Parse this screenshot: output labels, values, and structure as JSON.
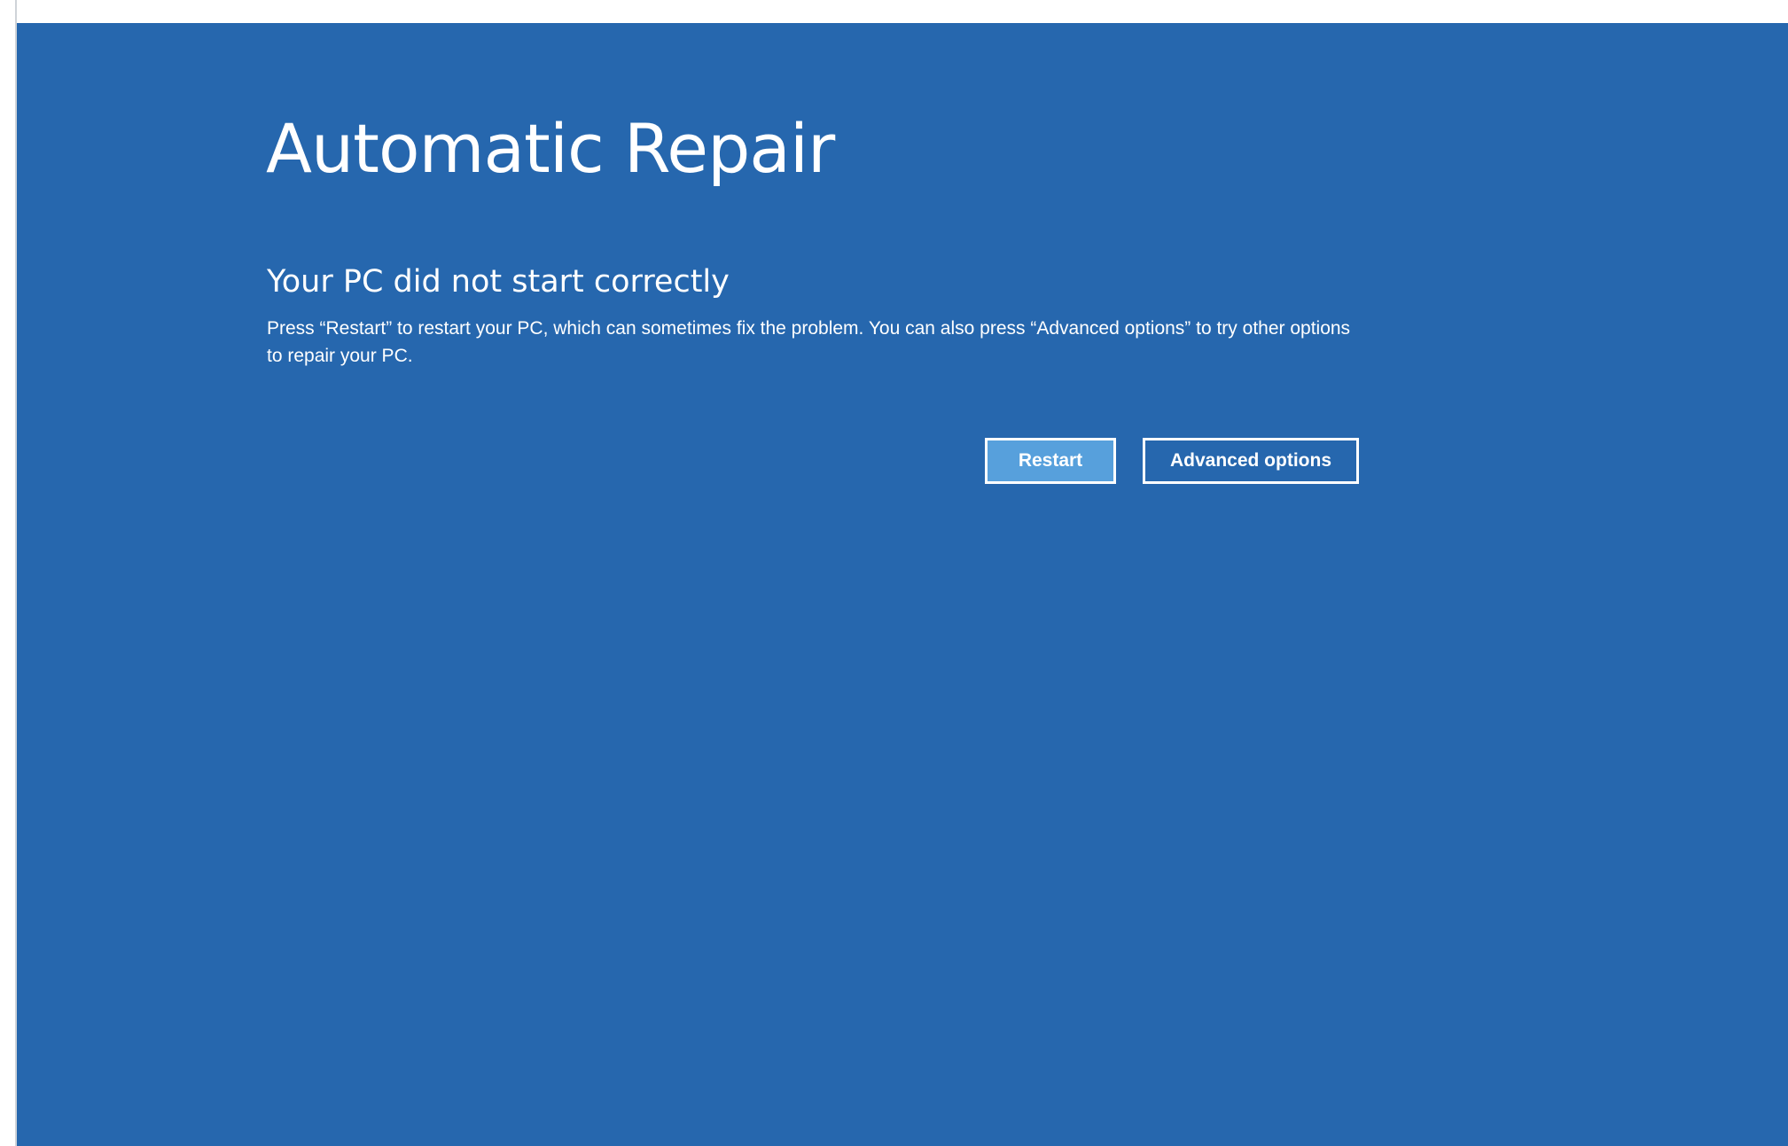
{
  "screen": {
    "title": "Automatic Repair",
    "subtitle": "Your PC did not start correctly",
    "description": "Press “Restart” to restart your PC, which can sometimes fix the problem. You can also press “Advanced options” to try other options to repair your PC."
  },
  "buttons": {
    "restart_label": "Restart",
    "advanced_label": "Advanced options"
  },
  "colors": {
    "background": "#2667ae",
    "primary_button": "#57a0dc",
    "text": "#ffffff"
  }
}
